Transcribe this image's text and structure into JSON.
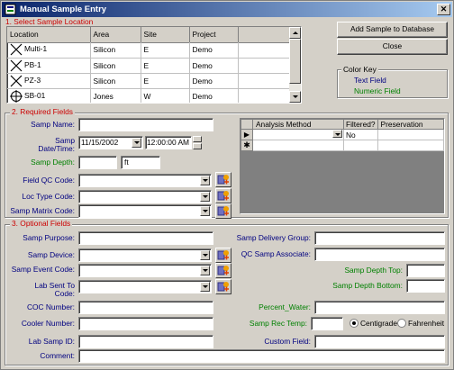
{
  "window": {
    "title": "Manual Sample Entry"
  },
  "sections": {
    "select_location": "1. Select Sample Location",
    "required": "2. Required Fields",
    "optional": "3. Optional Fields"
  },
  "location_table": {
    "headers": [
      "Location",
      "Area",
      "Site",
      "Project"
    ],
    "rows": [
      {
        "location": "Multi-1",
        "area": "Silicon",
        "site": "E",
        "project": "Demo",
        "icon": "x-marker-icon"
      },
      {
        "location": "PB-1",
        "area": "Silicon",
        "site": "E",
        "project": "Demo",
        "icon": "x-marker-icon"
      },
      {
        "location": "PZ-3",
        "area": "Silicon",
        "site": "E",
        "project": "Demo",
        "icon": "x-marker-icon"
      },
      {
        "location": "SB-01",
        "area": "Jones",
        "site": "W",
        "project": "Demo",
        "icon": "crosshair-marker-icon"
      }
    ]
  },
  "buttons": {
    "add": "Add Sample to Database",
    "close": "Close"
  },
  "color_key": {
    "title": "Color Key",
    "text_field": "Text Field",
    "numeric_field": "Numeric Field",
    "text_color": "#000080",
    "numeric_color": "#008000"
  },
  "required": {
    "samp_name": {
      "label": "Samp Name:",
      "value": ""
    },
    "samp_datetime": {
      "label1": "Samp",
      "label2": "Date/Time:",
      "date": "11/15/2002",
      "time": "12:00:00 AM"
    },
    "samp_depth": {
      "label": "Samp Depth:",
      "value": "",
      "unit": "ft"
    },
    "field_qc": {
      "label": "Field QC Code:",
      "value": ""
    },
    "loc_type": {
      "label": "Loc Type Code:",
      "value": ""
    },
    "samp_matrix": {
      "label": "Samp Matrix Code:",
      "value": ""
    }
  },
  "analysis_grid": {
    "headers": [
      "Analysis Method",
      "Filtered?",
      "Preservation"
    ],
    "rows": [
      {
        "method": "",
        "filtered": "No",
        "preservation": ""
      }
    ]
  },
  "optional": {
    "samp_purpose": "Samp Purpose:",
    "samp_device": "Samp Device:",
    "samp_event": "Samp Event Code:",
    "lab_sent_to1": "Lab Sent To",
    "lab_sent_to2": "Code:",
    "coc_number": "COC Number:",
    "cooler_number": "Cooler Number:",
    "lab_samp_id": "Lab Samp ID:",
    "comment": "Comment:",
    "delivery_group": "Samp Delivery Group:",
    "qc_associate": "QC Samp Associate:",
    "depth_top": "Samp Depth Top:",
    "depth_bottom": "Samp Depth Bottom:",
    "percent_water": "Percent_Water:",
    "rec_temp": "Samp Rec Temp:",
    "centigrade": "Centigrade",
    "fahrenheit": "Fahrenheit",
    "custom_field": "Custom Field:"
  }
}
